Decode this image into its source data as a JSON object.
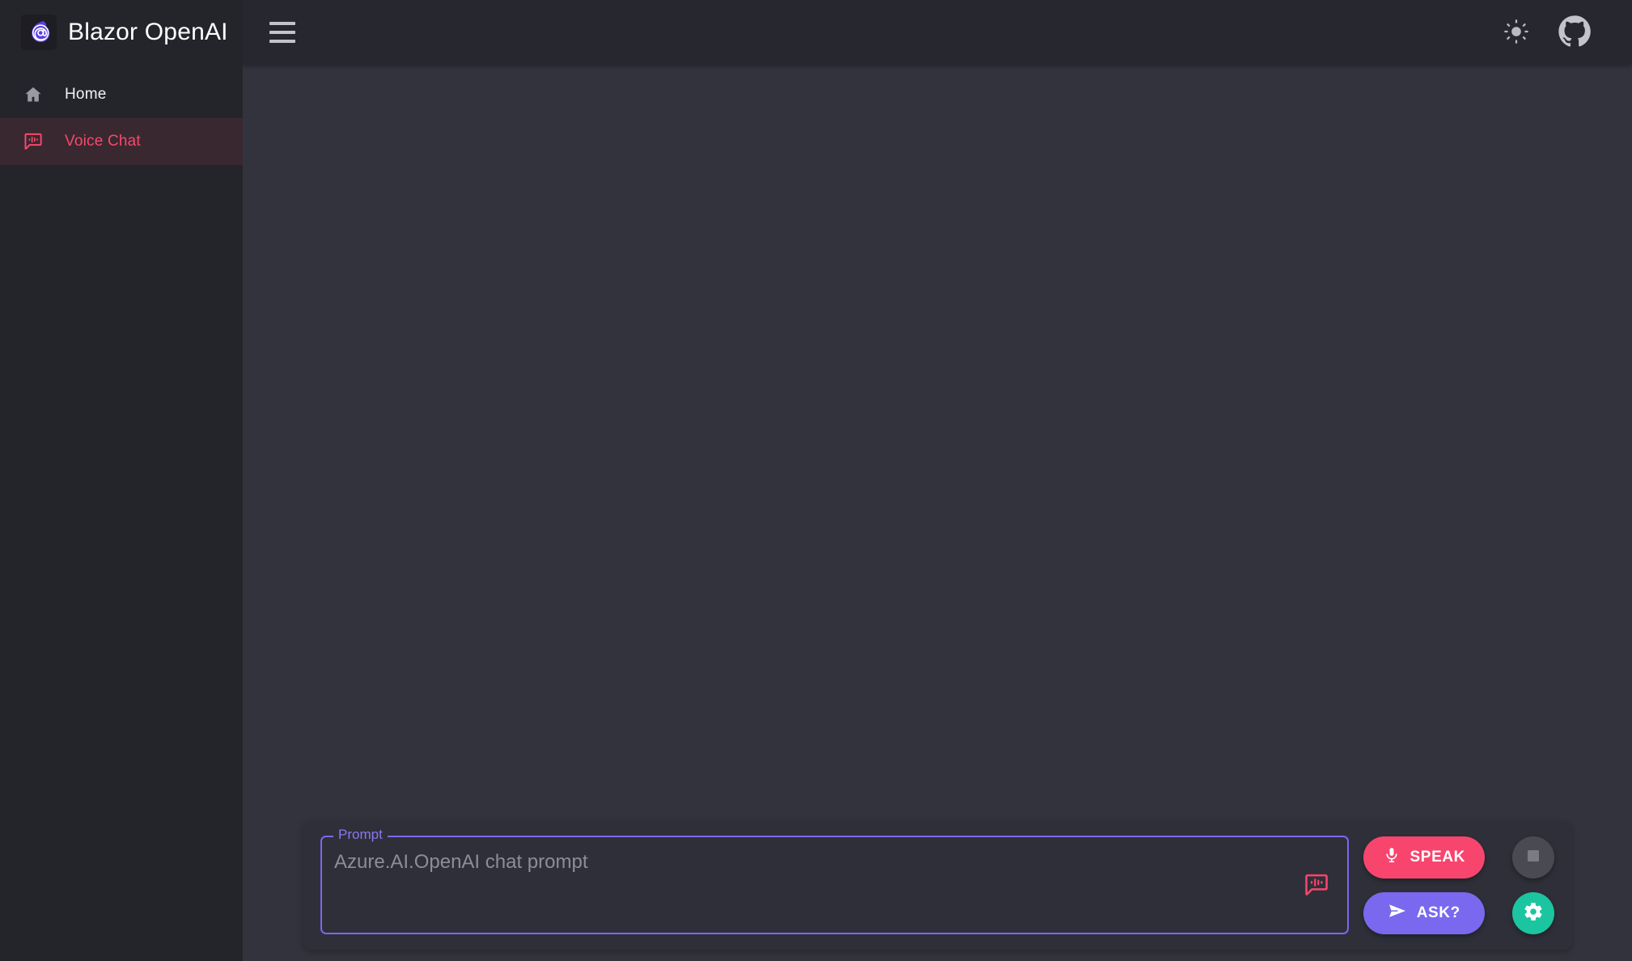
{
  "brand": {
    "title": "Blazor OpenAI",
    "logo_icon": "blazor-at-flame-logo"
  },
  "sidebar": {
    "items": [
      {
        "label": "Home",
        "icon": "home-icon",
        "active": false
      },
      {
        "label": "Voice Chat",
        "icon": "voice-chat-icon",
        "active": true
      }
    ]
  },
  "appbar": {
    "menu_icon": "hamburger-menu-icon",
    "theme_toggle_icon": "sun-icon",
    "github_icon": "github-icon"
  },
  "prompt_panel": {
    "field": {
      "legend": "Prompt",
      "value": "",
      "placeholder": "Azure.AI.OpenAI chat prompt",
      "voice_icon": "voice-chat-icon"
    },
    "buttons": {
      "speak": {
        "label": "SPEAK",
        "icon": "microphone-icon"
      },
      "ask": {
        "label": "ASK?",
        "icon": "send-icon"
      },
      "stop": {
        "icon": "stop-square-icon"
      },
      "settings": {
        "icon": "gear-icon"
      }
    }
  },
  "colors": {
    "accent_pink": "#f8456e",
    "accent_purple": "#7a68ee",
    "accent_teal": "#1bc5a0",
    "sidebar_bg": "#24242b",
    "appbar_bg": "#27272f",
    "main_bg": "#33333d",
    "panel_bg": "#2f2f39"
  }
}
